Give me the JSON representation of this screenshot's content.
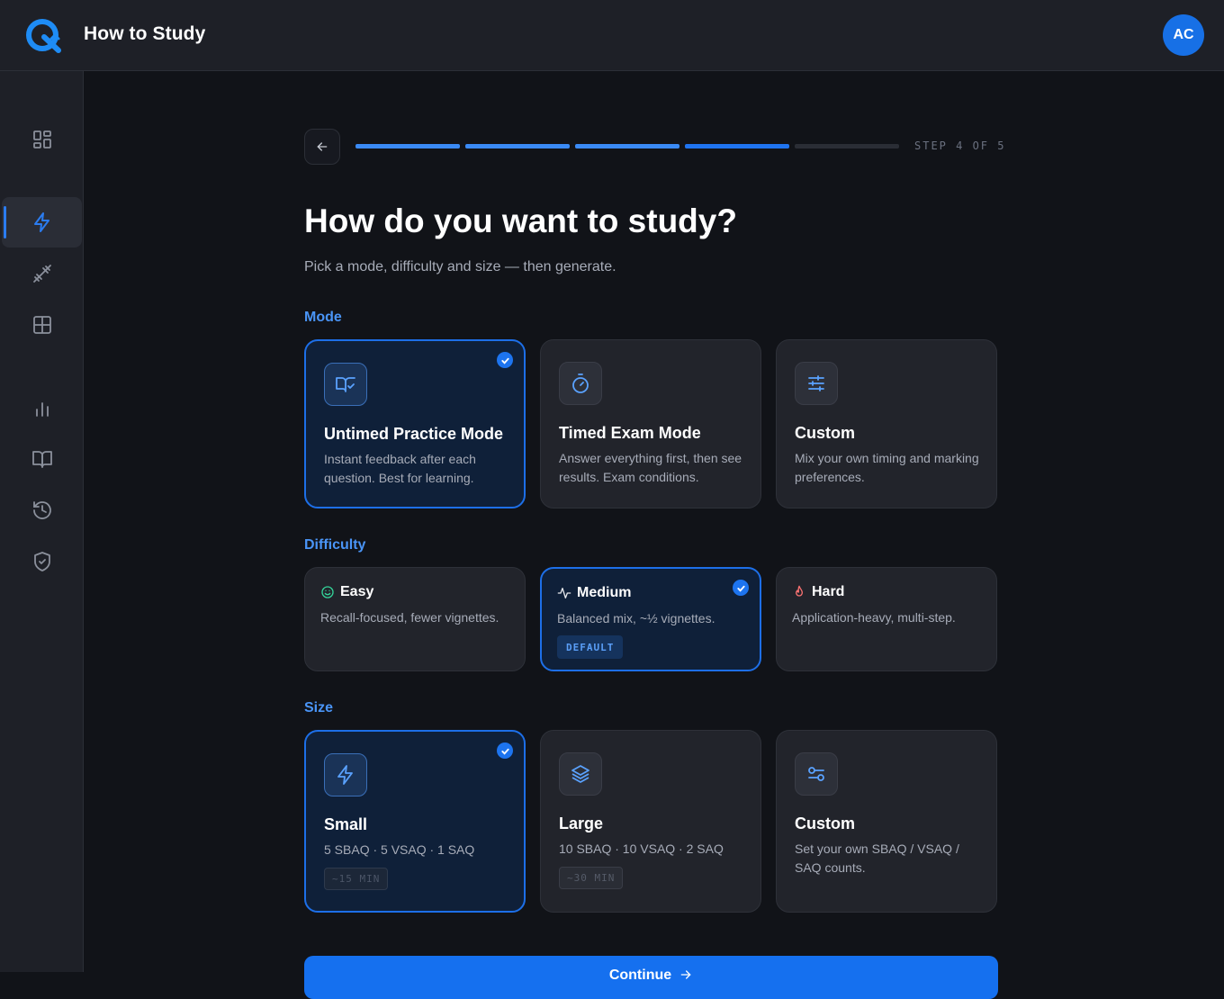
{
  "header": {
    "app_title": "How to Study",
    "avatar_initials": "AC",
    "logo_icon": "q-logo-icon"
  },
  "sidebar": {
    "items": [
      {
        "icon": "dashboard-icon",
        "active": false
      },
      {
        "icon": "lightning-icon",
        "active": true
      },
      {
        "icon": "dumbbell-icon",
        "active": false
      },
      {
        "icon": "grid-icon",
        "active": false
      },
      {
        "icon": "bar-chart-icon",
        "active": false
      },
      {
        "icon": "book-icon",
        "active": false
      },
      {
        "icon": "history-icon",
        "active": false
      },
      {
        "icon": "shield-check-icon",
        "active": false
      }
    ]
  },
  "wizard": {
    "step_label": "STEP 4 OF 5",
    "progress": {
      "current": 4,
      "total": 5
    },
    "title": "How do you want to study?",
    "subtitle": "Pick a mode, difficulty and size — then generate.",
    "continue_label": "Continue"
  },
  "mode": {
    "label": "Mode",
    "options": [
      {
        "title": "Untimed Practice Mode",
        "description": "Instant feedback after each question. Best for learning.",
        "icon": "book-check-icon",
        "selected": true
      },
      {
        "title": "Timed Exam Mode",
        "description": "Answer everything first, then see results. Exam conditions.",
        "icon": "stopwatch-icon",
        "selected": false
      },
      {
        "title": "Custom",
        "description": "Mix your own timing and marking preferences.",
        "icon": "sliders-icon",
        "selected": false
      }
    ]
  },
  "difficulty": {
    "label": "Difficulty",
    "options": [
      {
        "title": "Easy",
        "description": "Recall-focused, fewer vignettes.",
        "icon": "smile-icon",
        "selected": false
      },
      {
        "title": "Medium",
        "description": "Balanced mix, ~½ vignettes.",
        "icon": "activity-icon",
        "selected": true,
        "badge": "DEFAULT"
      },
      {
        "title": "Hard",
        "description": "Application-heavy, multi-step.",
        "icon": "flame-icon",
        "selected": false
      }
    ]
  },
  "size": {
    "label": "Size",
    "options": [
      {
        "title": "Small",
        "description": "5 SBAQ · 5 VSAQ · 1 SAQ",
        "icon": "lightning-icon",
        "selected": true,
        "time": "~15 MIN"
      },
      {
        "title": "Large",
        "description": "10 SBAQ · 10 VSAQ · 2 SAQ",
        "icon": "layers-icon",
        "selected": false,
        "time": "~30 MIN"
      },
      {
        "title": "Custom",
        "description": "Set your own SBAQ / VSAQ / SAQ counts.",
        "icon": "toggles-icon",
        "selected": false
      }
    ]
  },
  "colors": {
    "accent": "#1d74ef",
    "background": "#111318",
    "panel": "#1e2027",
    "easy": "#34d399",
    "hard": "#f87171"
  }
}
